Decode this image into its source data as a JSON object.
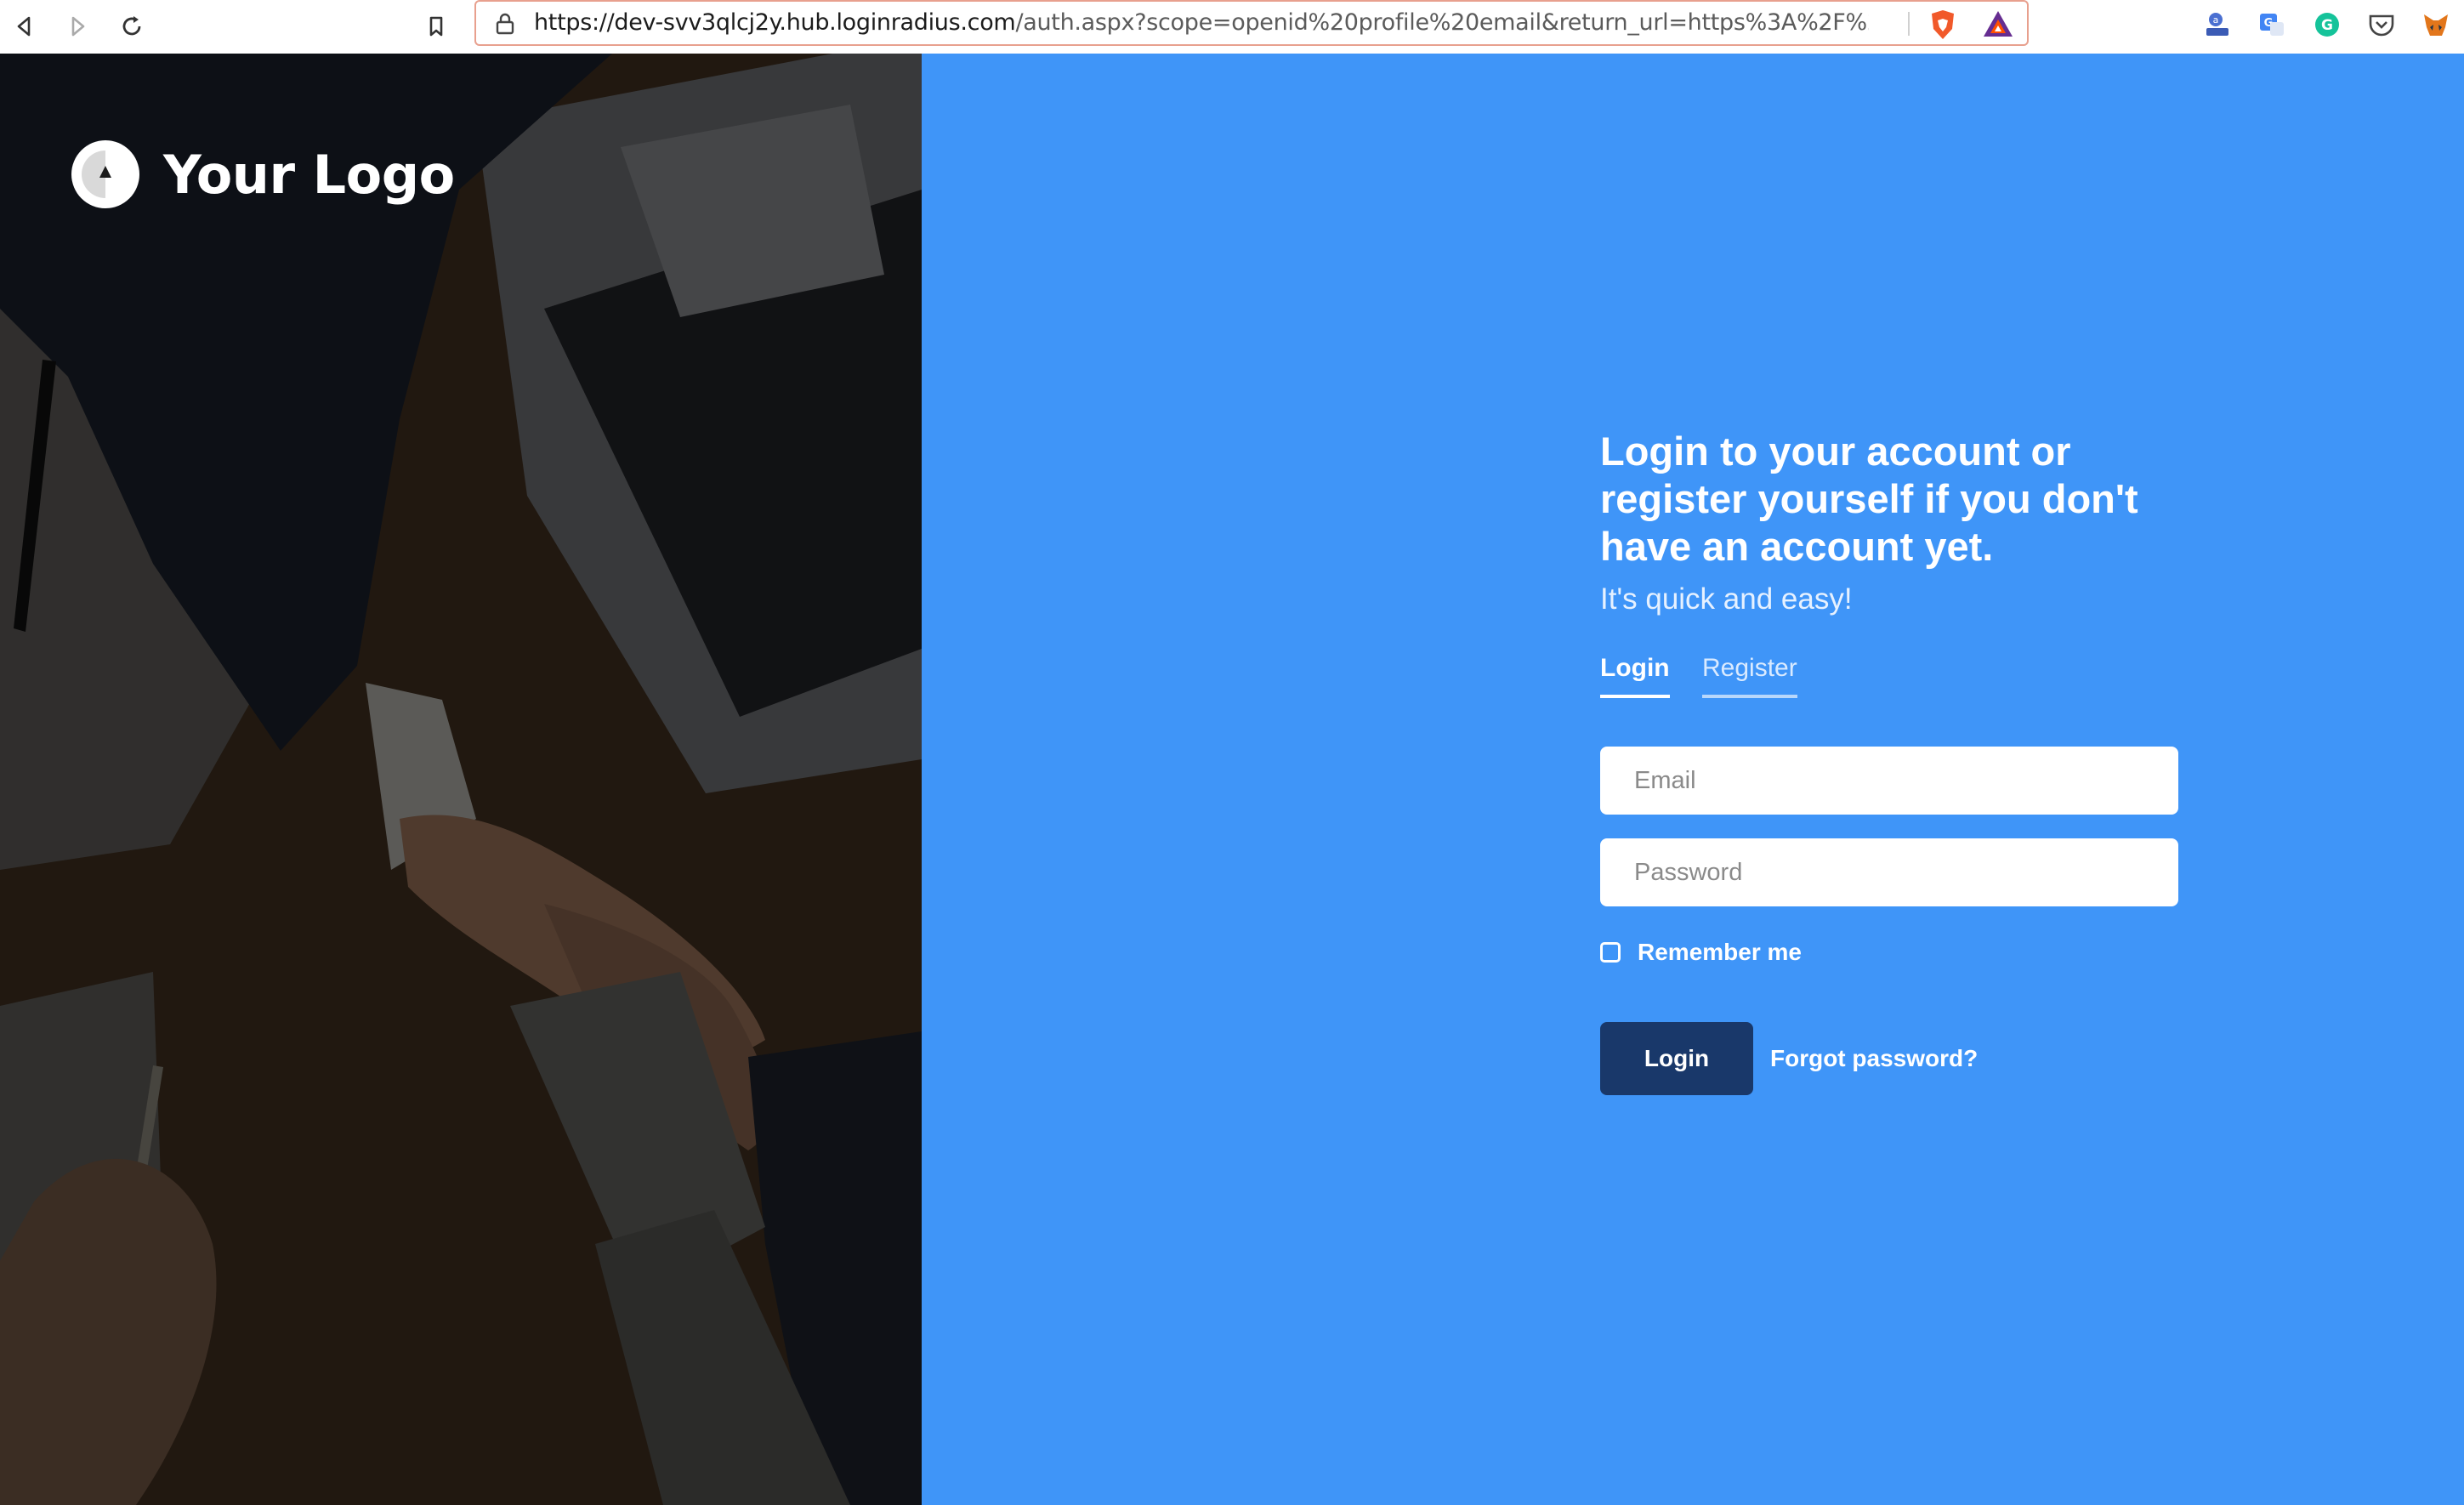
{
  "browser": {
    "url_host": "https://dev-svv3qlcj2y.hub.loginradius.com",
    "url_path": "/auth.aspx?scope=openid%20profile%20email&return_url=https%3A%2F%2..."
  },
  "brand": {
    "logo_text": "Your Logo"
  },
  "login_form": {
    "headline": "Login to your account or register yourself if you don't have an account yet.",
    "subline": "It's quick and easy!",
    "tabs": [
      {
        "label": "Login",
        "active": true
      },
      {
        "label": "Register",
        "active": false
      }
    ],
    "email_placeholder": "Email",
    "password_placeholder": "Password",
    "remember_label": "Remember me",
    "remember_checked": false,
    "login_button": "Login",
    "forgot_link": "Forgot password?"
  },
  "colors": {
    "panel_blue": "#3f95f8",
    "button_navy": "#19386a"
  },
  "icons": [
    "back-icon",
    "forward-icon",
    "reload-icon",
    "bookmark-icon",
    "lock-icon",
    "brave-shield-icon",
    "bat-rewards-icon",
    "translate-extension-icon",
    "google-translate-icon",
    "grammarly-icon",
    "pocket-icon",
    "metamask-icon"
  ]
}
